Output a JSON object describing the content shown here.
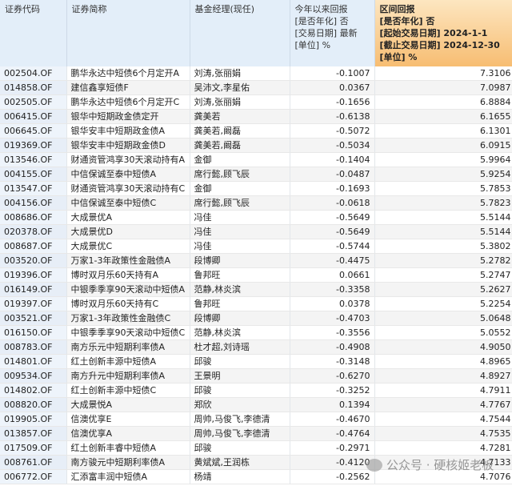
{
  "headers": {
    "code": "证券代码",
    "name": "证券简称",
    "manager": "基金经理(现任)",
    "ytd": [
      "今年以来回报",
      "[是否年化] 否",
      "[交易日期] 最新",
      "[单位] %"
    ],
    "range": [
      "区间回报",
      "[是否年化] 否",
      "[起始交易日期] 2024-1-1",
      "[截止交易日期] 2024-12-30",
      "[单位] %"
    ]
  },
  "rows": [
    [
      "002504.OF",
      "鹏华永达中短债6个月定开A",
      "刘涛,张丽娟",
      "-0.1007",
      "7.3106"
    ],
    [
      "014858.OF",
      "建信鑫享短债F",
      "吴沛文,李星佑",
      "0.0367",
      "7.0987"
    ],
    [
      "002505.OF",
      "鹏华永达中短债6个月定开C",
      "刘涛,张丽娟",
      "-0.1656",
      "6.8884"
    ],
    [
      "006415.OF",
      "银华中短期政金债定开",
      "龚美若",
      "-0.6138",
      "6.1655"
    ],
    [
      "006645.OF",
      "银华安丰中短期政金债A",
      "龚美若,阚磊",
      "-0.5072",
      "6.1301"
    ],
    [
      "019369.OF",
      "银华安丰中短期政金债D",
      "龚美若,阚磊",
      "-0.5034",
      "6.0915"
    ],
    [
      "013546.OF",
      "财通资管鸿享30天滚动持有A",
      "金御",
      "-0.1404",
      "5.9964"
    ],
    [
      "004155.OF",
      "中信保诚至泰中短债A",
      "席行懿,顾飞辰",
      "-0.0487",
      "5.9254"
    ],
    [
      "013547.OF",
      "财通资管鸿享30天滚动持有C",
      "金御",
      "-0.1693",
      "5.7853"
    ],
    [
      "004156.OF",
      "中信保诚至泰中短债C",
      "席行懿,顾飞辰",
      "-0.0618",
      "5.7823"
    ],
    [
      "008686.OF",
      "大成景优A",
      "冯佳",
      "-0.5649",
      "5.5144"
    ],
    [
      "020378.OF",
      "大成景优D",
      "冯佳",
      "-0.5649",
      "5.5144"
    ],
    [
      "008687.OF",
      "大成景优C",
      "冯佳",
      "-0.5744",
      "5.3802"
    ],
    [
      "003520.OF",
      "万家1-3年政策性金融债A",
      "段博卿",
      "-0.4475",
      "5.2782"
    ],
    [
      "019396.OF",
      "博时双月乐60天持有A",
      "鲁邦旺",
      "0.0661",
      "5.2747"
    ],
    [
      "016149.OF",
      "中银季季享90天滚动中短债A",
      "范静,林炎滨",
      "-0.3358",
      "5.2627"
    ],
    [
      "019397.OF",
      "博时双月乐60天持有C",
      "鲁邦旺",
      "0.0378",
      "5.2254"
    ],
    [
      "003521.OF",
      "万家1-3年政策性金融债C",
      "段博卿",
      "-0.4703",
      "5.0648"
    ],
    [
      "016150.OF",
      "中银季季享90天滚动中短债C",
      "范静,林炎滨",
      "-0.3556",
      "5.0552"
    ],
    [
      "008783.OF",
      "南方乐元中短期利率债A",
      "杜才超,刘诗瑶",
      "-0.4908",
      "4.9050"
    ],
    [
      "014801.OF",
      "红土创新丰源中短债A",
      "邱骏",
      "-0.3148",
      "4.8965"
    ],
    [
      "009534.OF",
      "南方升元中短期利率债A",
      "王景明",
      "-0.6270",
      "4.8927"
    ],
    [
      "014802.OF",
      "红土创新丰源中短债C",
      "邱骏",
      "-0.3252",
      "4.7911"
    ],
    [
      "008820.OF",
      "大成景悦A",
      "郑欣",
      "0.1394",
      "4.7767"
    ],
    [
      "019905.OF",
      "信澳优享E",
      "周帅,马俊飞,李德清",
      "-0.4670",
      "4.7544"
    ],
    [
      "013857.OF",
      "信澳优享A",
      "周帅,马俊飞,李德清",
      "-0.4764",
      "4.7535"
    ],
    [
      "017509.OF",
      "红土创新丰睿中短债A",
      "邱骏",
      "-0.2971",
      "4.7281"
    ],
    [
      "008761.OF",
      "南方骏元中短期利率债A",
      "黄斌斌,王润栋",
      "-0.4120",
      "4.7133"
    ],
    [
      "006772.OF",
      "汇添富丰润中短债A",
      "杨靖",
      "-0.2562",
      "4.7076"
    ]
  ],
  "watermark": "公众号 · 硬核姬老板"
}
